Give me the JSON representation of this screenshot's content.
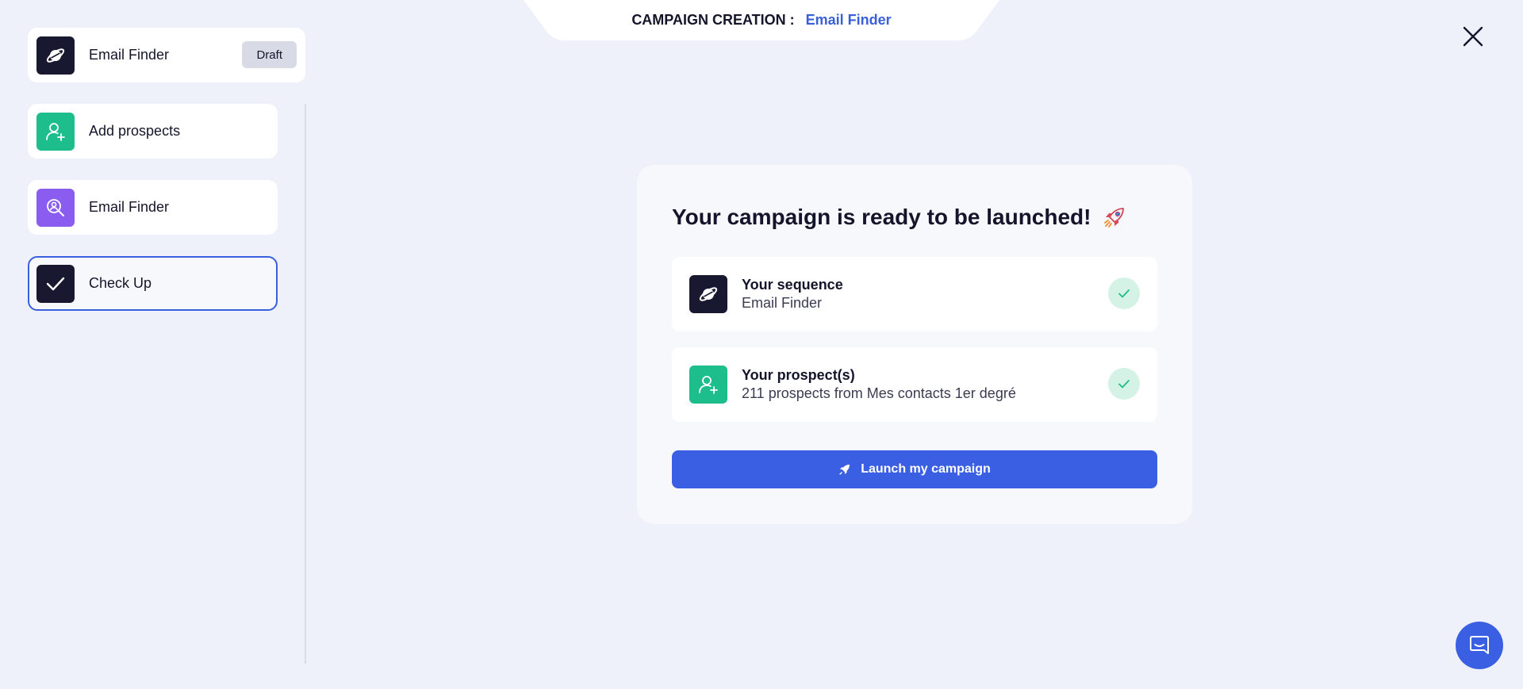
{
  "header": {
    "prefix": "CAMPAIGN CREATION :",
    "campaign_name": "Email Finder"
  },
  "sidebar": {
    "campaign": {
      "label": "Email Finder",
      "badge": "Draft",
      "icon": "planet-icon"
    },
    "items": [
      {
        "label": "Add prospects",
        "icon": "add-user-icon",
        "color": "#1ebe8c"
      },
      {
        "label": "Email Finder",
        "icon": "user-search-icon",
        "color": "#8a5cf0"
      },
      {
        "label": "Check Up",
        "icon": "check-icon",
        "color": "#181830",
        "active": true
      }
    ]
  },
  "main": {
    "title": "Your campaign is ready to be launched!",
    "rows": [
      {
        "heading": "Your sequence",
        "detail": "Email Finder",
        "icon": "planet-icon",
        "status": "check-icon"
      },
      {
        "heading": "Your prospect(s)",
        "detail": "211 prospects from Mes contacts 1er degré",
        "icon": "add-user-icon",
        "status": "check-icon"
      }
    ],
    "launch_button": "Launch my campaign"
  },
  "colors": {
    "accent": "#3a5fe2",
    "background": "#eef0fa",
    "success": "#1ebe8c"
  }
}
